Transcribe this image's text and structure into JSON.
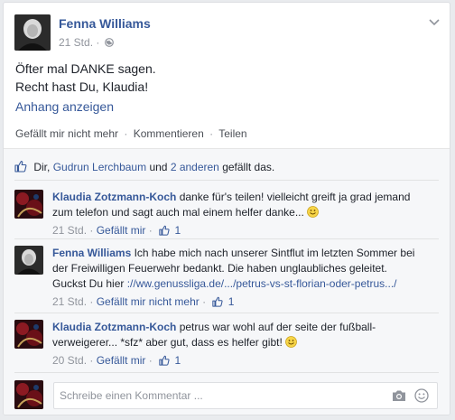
{
  "post": {
    "author": "Fenna Williams",
    "time": "21 Std.",
    "dot": "·",
    "text_line1": "Öfter mal DANKE sagen.",
    "text_line2": "Recht hast Du, Klaudia!",
    "attachment_link": "Anhang anzeigen",
    "actions": {
      "unlike": "Gefällt mir nicht mehr",
      "comment": "Kommentieren",
      "share": "Teilen",
      "sep": "·"
    }
  },
  "likes": {
    "prefix": "Dir,",
    "person": "Gudrun Lerchbaum",
    "and": "und",
    "others": "2 anderen",
    "suffix": "gefällt das."
  },
  "comments": [
    {
      "author": "Klaudia Zotzmann-Koch",
      "text": "danke für's teilen! vielleicht greift ja grad jemand zum telefon und sagt auch mal einem helfer danke...",
      "time": "21 Std.",
      "like_action": "Gefällt mir",
      "like_count": "1"
    },
    {
      "author": "Fenna Williams",
      "text": "Ich habe mich nach unserer Sintflut im letzten Sommer bei der Freiwilligen Feuerwehr bedankt. Die haben unglaubliches geleitet. Guckst Du hier",
      "link": "://ww.genussliga.de/.../petrus-vs-st-florian-oder-petrus.../",
      "time": "21 Std.",
      "like_action": "Gefällt mir nicht mehr",
      "like_count": "1"
    },
    {
      "author": "Klaudia Zotzmann-Koch",
      "text": "petrus war wohl auf der seite der fußball-verweigerer... *sfz* aber gut, dass es helfer gibt!",
      "time": "20 Std.",
      "like_action": "Gefällt mir",
      "like_count": "1"
    }
  ],
  "composer": {
    "placeholder": "Schreibe einen Kommentar ..."
  },
  "colors": {
    "link": "#365899",
    "muted": "#90949c",
    "background": "#f6f7f9"
  }
}
